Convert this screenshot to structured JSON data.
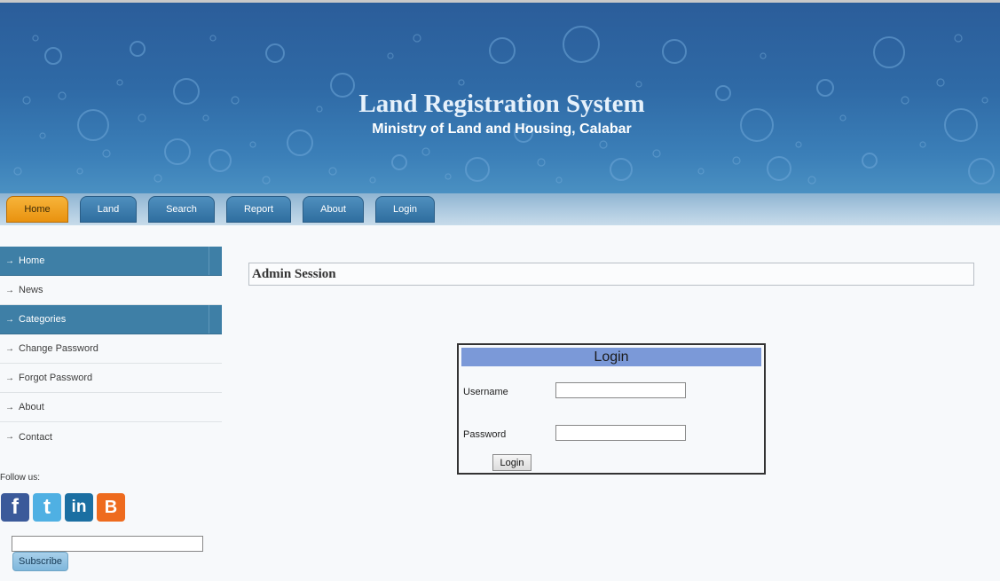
{
  "header": {
    "title": "Land Registration System",
    "subtitle": "Ministry of Land and Housing, Calabar"
  },
  "nav": {
    "tabs": [
      {
        "label": "Home",
        "active": true
      },
      {
        "label": "Land",
        "active": false
      },
      {
        "label": "Search",
        "active": false
      },
      {
        "label": "Report",
        "active": false
      },
      {
        "label": "About",
        "active": false
      },
      {
        "label": "Login",
        "active": false
      }
    ]
  },
  "sidebar": {
    "items": [
      {
        "label": "Home",
        "style": "dark"
      },
      {
        "label": "News",
        "style": "light"
      },
      {
        "label": "Categories",
        "style": "dark"
      },
      {
        "label": "Change Password",
        "style": "light"
      },
      {
        "label": "Forgot Password",
        "style": "light"
      },
      {
        "label": "About",
        "style": "light"
      },
      {
        "label": "Contact",
        "style": "light"
      }
    ],
    "arrow_glyph": "→",
    "follow_label": "Follow us:",
    "social": [
      {
        "icon": "facebook-icon",
        "glyph": "f",
        "color": "#3b5a9a"
      },
      {
        "icon": "twitter-icon",
        "glyph": "t",
        "color": "#4fb0e3"
      },
      {
        "icon": "linkedin-icon",
        "glyph": "in",
        "color": "#1b6fa2"
      },
      {
        "icon": "blogger-icon",
        "glyph": "B",
        "color": "#ee6b1e"
      }
    ],
    "subscribe": {
      "input_value": "",
      "button_label": "Subscribe"
    }
  },
  "main": {
    "session_title": "Admin Session",
    "login": {
      "header": "Login",
      "username_label": "Username",
      "username_value": "",
      "password_label": "Password",
      "password_value": "",
      "button_label": "Login"
    }
  },
  "colors": {
    "accent_orange": "#e9920f",
    "nav_blue": "#2f6e9f",
    "sidebar_dark": "#3e7fa6",
    "login_header": "#7b99d8"
  }
}
